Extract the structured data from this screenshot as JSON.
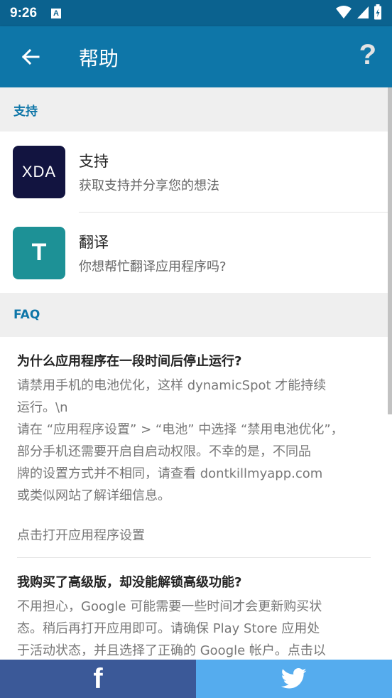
{
  "status_bar": {
    "time": "9:26",
    "notif_letter": "A"
  },
  "app_bar": {
    "title": "帮助",
    "help_glyph": "?"
  },
  "sections": {
    "support_header": "支持",
    "faq_header": "FAQ"
  },
  "support_items": [
    {
      "icon_text": "XDA",
      "title": "支持",
      "subtitle": "获取支持并分享您的想法"
    },
    {
      "icon_text": "T",
      "title": "翻译",
      "subtitle": "你想帮忙翻译应用程序吗?"
    }
  ],
  "faq": [
    {
      "question": "为什么应用程序在一段时间后停止运行?",
      "answer_lines": [
        "请禁用手机的电池优化，这样 dynamicSpot 才能持续",
        "运行。\\n",
        "请在 “应用程序设置” > “电池” 中选择 “禁用电池优化”，",
        "部分手机还需要开启自启动权限。不幸的是，不同品",
        "牌的设置方式并不相同，请查看 dontkillmyapp.com",
        "或类似网站了解详细信息。"
      ],
      "link": "点击打开应用程序设置"
    },
    {
      "question": "我购买了高级版，却没能解锁高级功能?",
      "answer_lines": [
        "不用担心，Google 可能需要一些时间才会更新购买状",
        "态。稍后再打开应用即可。请确保 Play Store 应用处",
        "于活动状态，并且选择了正确的 Google 帐户。点击以"
      ]
    }
  ],
  "bottom_bar": {
    "facebook_glyph": "f"
  },
  "colors": {
    "status_bar": "#0b628f",
    "app_bar": "#0e76a8",
    "facebook": "#3b5998",
    "twitter": "#55acee",
    "xda_icon": "#121440",
    "translate_icon": "#1d9196"
  }
}
